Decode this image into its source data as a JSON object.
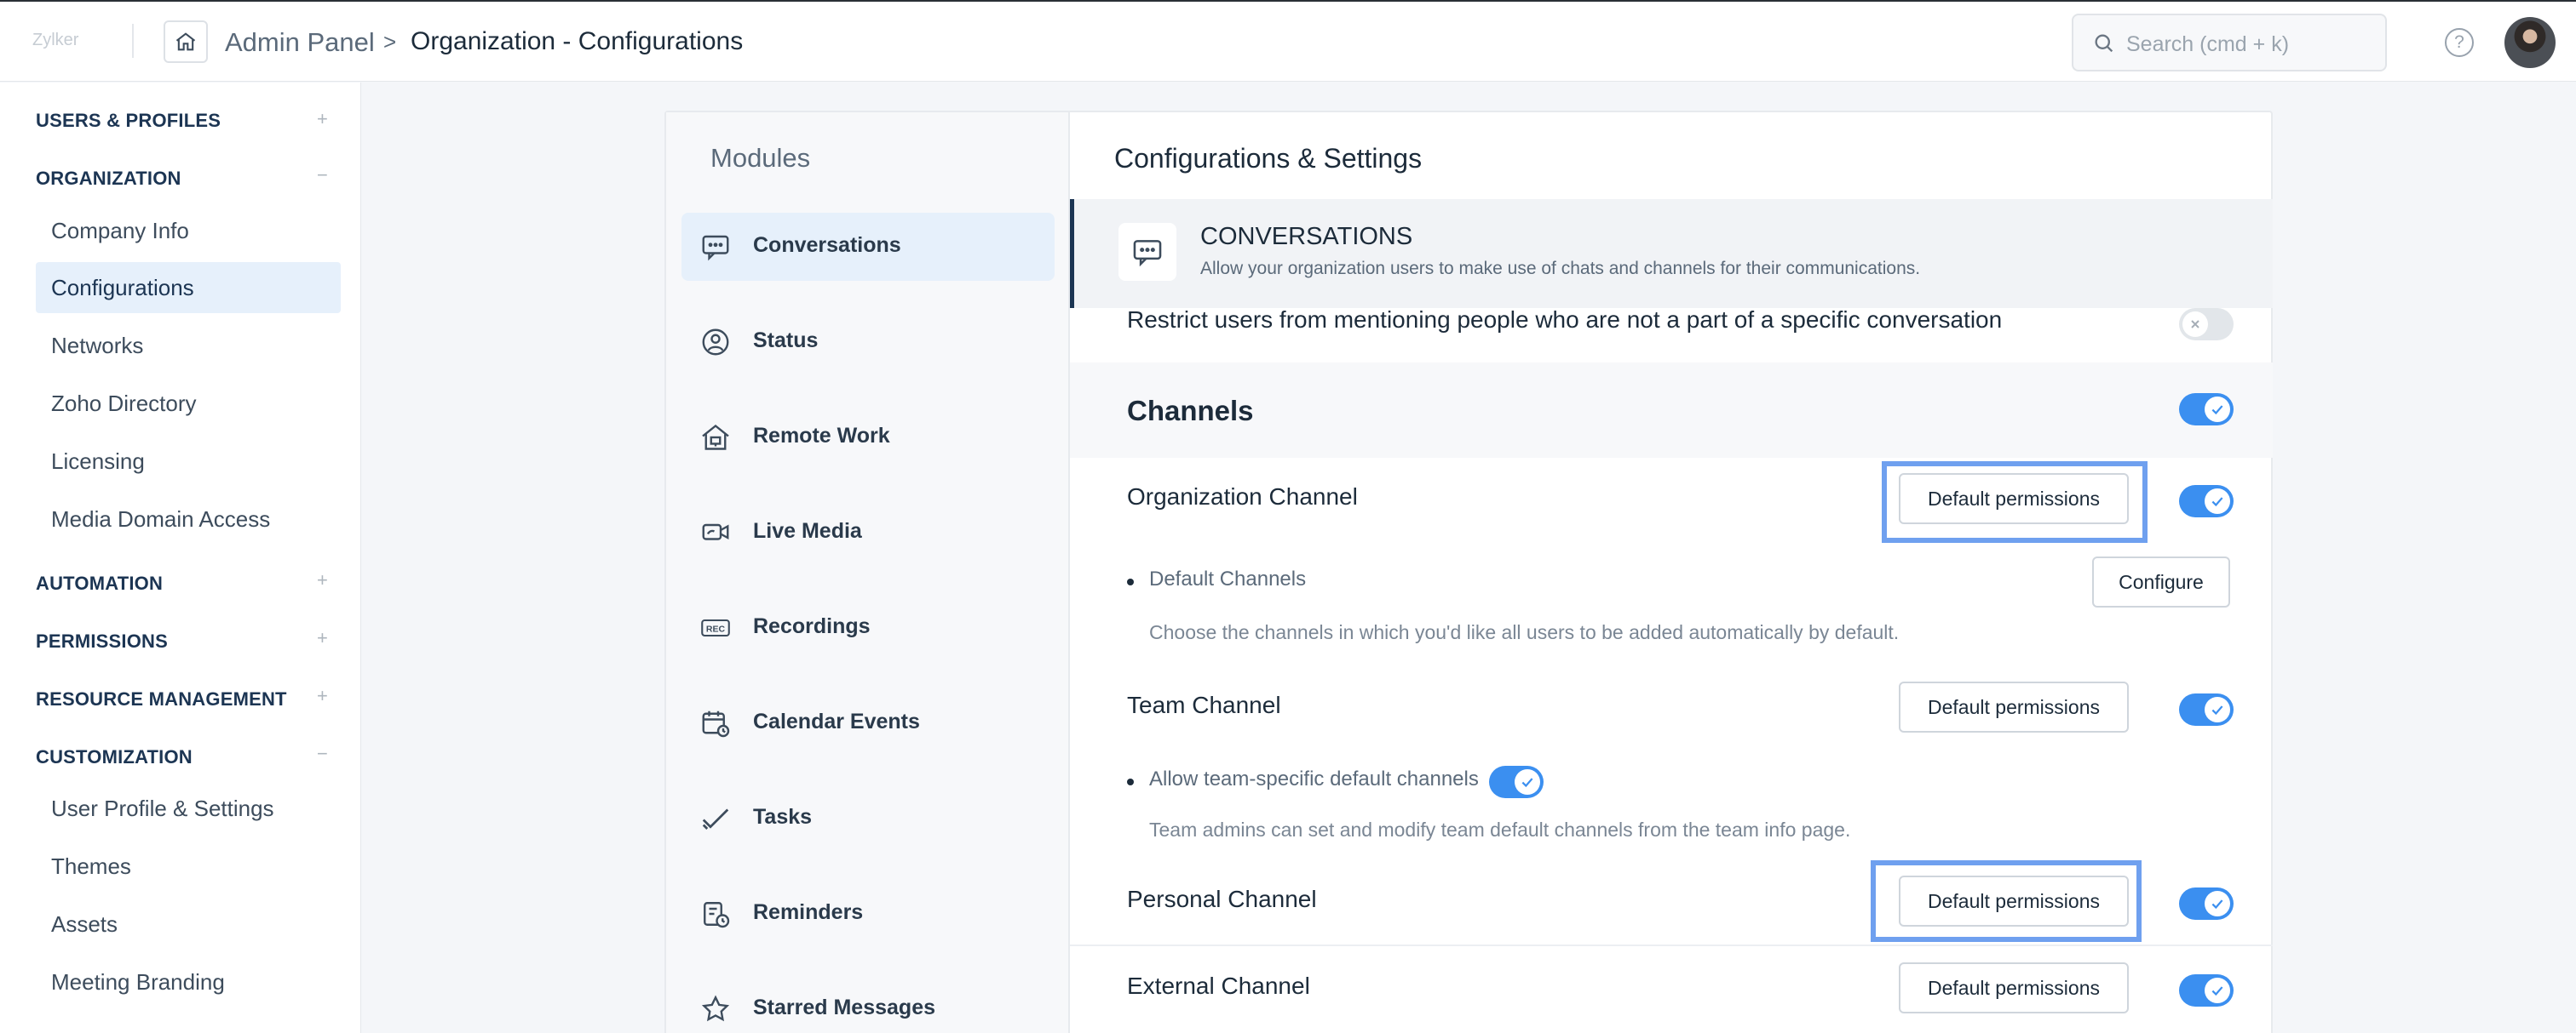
{
  "header": {
    "logo": "Zylker",
    "breadcrumb_root": "Admin Panel",
    "breadcrumb_sep": ">",
    "breadcrumb_current": "Organization - Configurations",
    "search_placeholder": "Search (cmd + k)",
    "help_glyph": "?"
  },
  "sidebar": {
    "users_profiles": "USERS & PROFILES",
    "organization": "ORGANIZATION",
    "org_items": [
      "Company Info",
      "Configurations",
      "Networks",
      "Zoho Directory",
      "Licensing",
      "Media Domain Access"
    ],
    "automation": "AUTOMATION",
    "permissions": "PERMISSIONS",
    "resource_management": "RESOURCE MANAGEMENT",
    "customization": "CUSTOMIZATION",
    "custom_items": [
      "User Profile & Settings",
      "Themes",
      "Assets",
      "Meeting Branding"
    ],
    "expand_glyph": "+",
    "collapse_glyph": "−"
  },
  "modules": {
    "title": "Modules",
    "items": [
      {
        "label": "Conversations",
        "icon": "chat-icon"
      },
      {
        "label": "Status",
        "icon": "status-icon"
      },
      {
        "label": "Remote Work",
        "icon": "home-office-icon"
      },
      {
        "label": "Live Media",
        "icon": "video-call-icon"
      },
      {
        "label": "Recordings",
        "icon": "rec-icon"
      },
      {
        "label": "Calendar Events",
        "icon": "calendar-icon"
      },
      {
        "label": "Tasks",
        "icon": "check-icon"
      },
      {
        "label": "Reminders",
        "icon": "reminder-icon"
      },
      {
        "label": "Starred Messages",
        "icon": "star-icon"
      }
    ]
  },
  "settings": {
    "title": "Configurations & Settings",
    "section_title": "CONVERSATIONS",
    "section_desc": "Allow your organization users to make use of chats and channels for their communications.",
    "restrict_mentions": "Restrict users from mentioning people who are not a part of a specific conversation",
    "channels": "Channels",
    "org_channel": "Organization Channel",
    "default_permissions": "Default permissions",
    "default_channels": "Default Channels",
    "configure": "Configure",
    "default_channels_help": "Choose the channels in which you'd like all users to be added automatically by default.",
    "team_channel": "Team Channel",
    "allow_team_defaults": "Allow team-specific default channels",
    "team_help": "Team admins can set and modify team default channels from the team info page.",
    "personal_channel": "Personal Channel",
    "external_channel": "External Channel"
  },
  "colors": {
    "accent": "#3b8ff0",
    "highlight": "#6fa0ef",
    "active_bg": "#e6f0fb",
    "navy": "#1c3553"
  }
}
